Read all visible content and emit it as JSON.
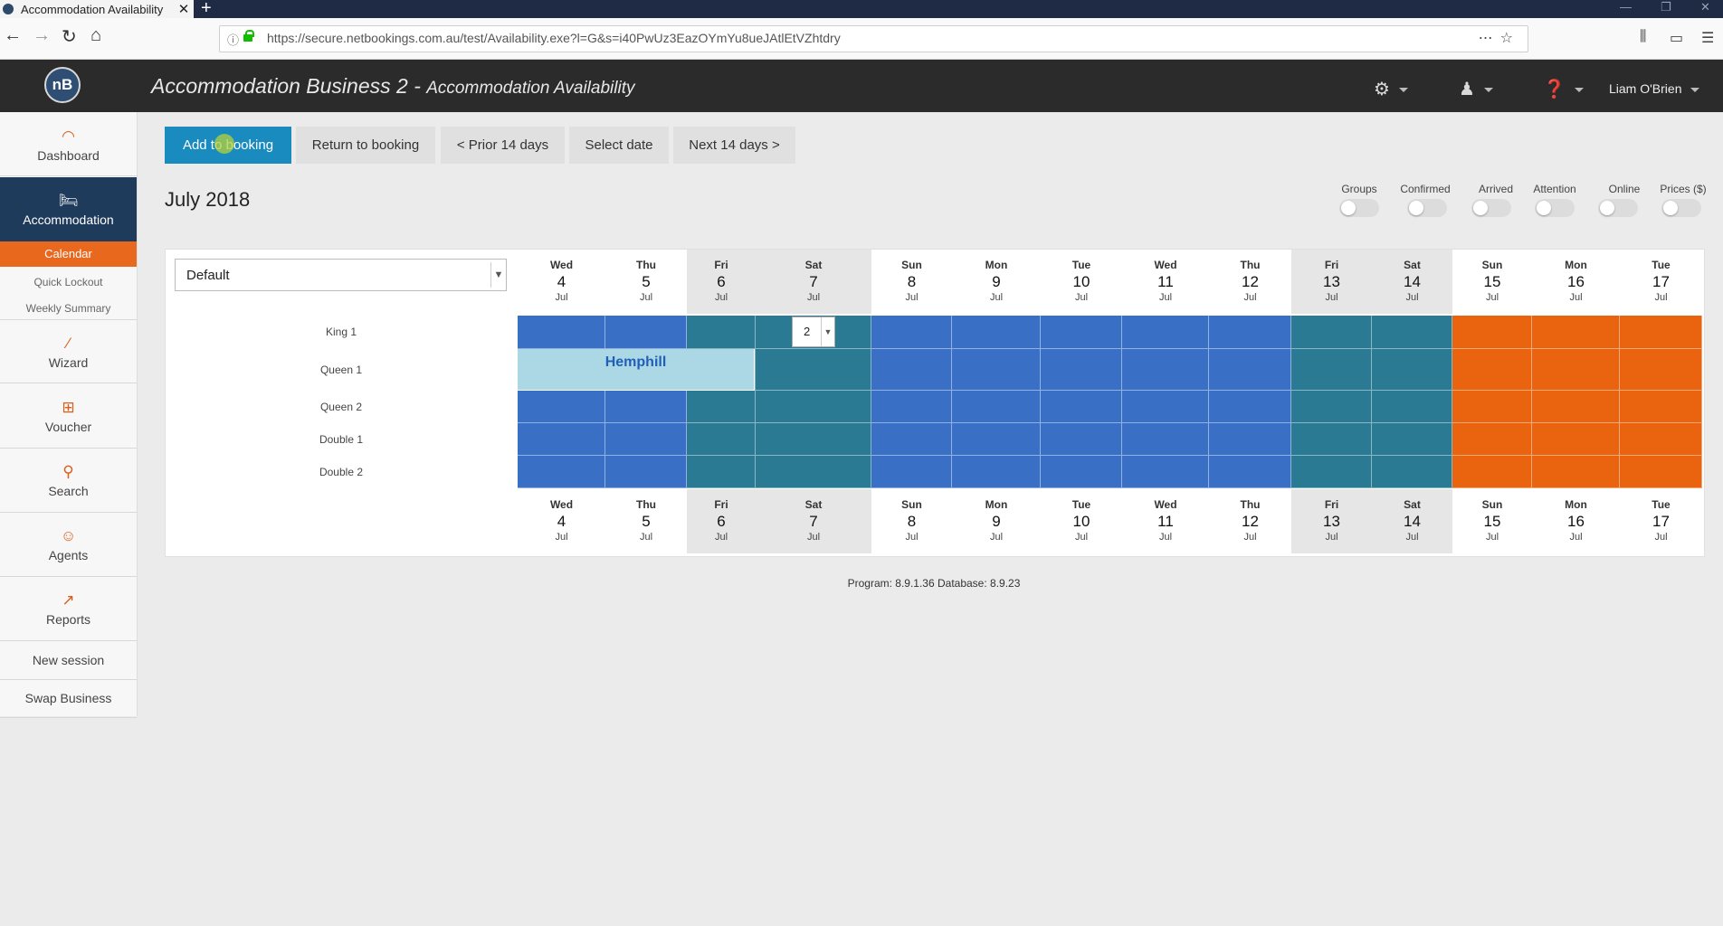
{
  "browser": {
    "tab_title": "Accommodation Availability",
    "url": "https://secure.netbookings.com.au/test/Availability.exe?l=G&s=i40PwUz3EazOYmYu8ueJAtlEtVZhtdry"
  },
  "header": {
    "logo": "nB",
    "business": "Accommodation Business 2 - ",
    "page": "Accommodation Availability",
    "user": "Liam O'Brien"
  },
  "sidebar": {
    "dashboard": "Dashboard",
    "accommodation": "Accommodation",
    "calendar": "Calendar",
    "quick_lockout": "Quick Lockout",
    "weekly_summary": "Weekly Summary",
    "wizard": "Wizard",
    "voucher": "Voucher",
    "search": "Search",
    "agents": "Agents",
    "reports": "Reports",
    "new_session": "New session",
    "swap_business": "Swap Business"
  },
  "toolbar": {
    "add": "Add to booking",
    "return": "Return to booking",
    "prior": "< Prior 14 days",
    "select_date": "Select date",
    "next": "Next 14 days >"
  },
  "month": "July 2018",
  "toggles": {
    "groups": "Groups",
    "confirmed": "Confirmed",
    "arrived": "Arrived",
    "attention": "Attention",
    "online": "Online",
    "prices": "Prices ($)"
  },
  "grid": {
    "view": "Default",
    "month_abbr": "Jul",
    "days": [
      {
        "dow": "Wed",
        "num": "4"
      },
      {
        "dow": "Thu",
        "num": "5"
      },
      {
        "dow": "Fri",
        "num": "6"
      },
      {
        "dow": "Sat",
        "num": "7"
      },
      {
        "dow": "Sun",
        "num": "8"
      },
      {
        "dow": "Mon",
        "num": "9"
      },
      {
        "dow": "Tue",
        "num": "10"
      },
      {
        "dow": "Wed",
        "num": "11"
      },
      {
        "dow": "Thu",
        "num": "12"
      },
      {
        "dow": "Fri",
        "num": "13"
      },
      {
        "dow": "Sat",
        "num": "14"
      },
      {
        "dow": "Sun",
        "num": "15"
      },
      {
        "dow": "Mon",
        "num": "16"
      },
      {
        "dow": "Tue",
        "num": "17"
      }
    ],
    "rooms": [
      "King 1",
      "Queen 1",
      "Queen 2",
      "Double 1",
      "Double 2"
    ],
    "booking_guest": "Hemphill",
    "nights_value": "2"
  },
  "footer": {
    "version": "Program: 8.9.1.36 Database: 8.9.23"
  },
  "colors": {
    "weekday": "#3a6fc6",
    "weekend": "#2a7a94",
    "priced": "#ea6410",
    "booking": "#acd8e6",
    "primary_button": "#1a8bbf",
    "sidebar_active": "#1f3b5c",
    "submenu_active": "#e8681e"
  }
}
